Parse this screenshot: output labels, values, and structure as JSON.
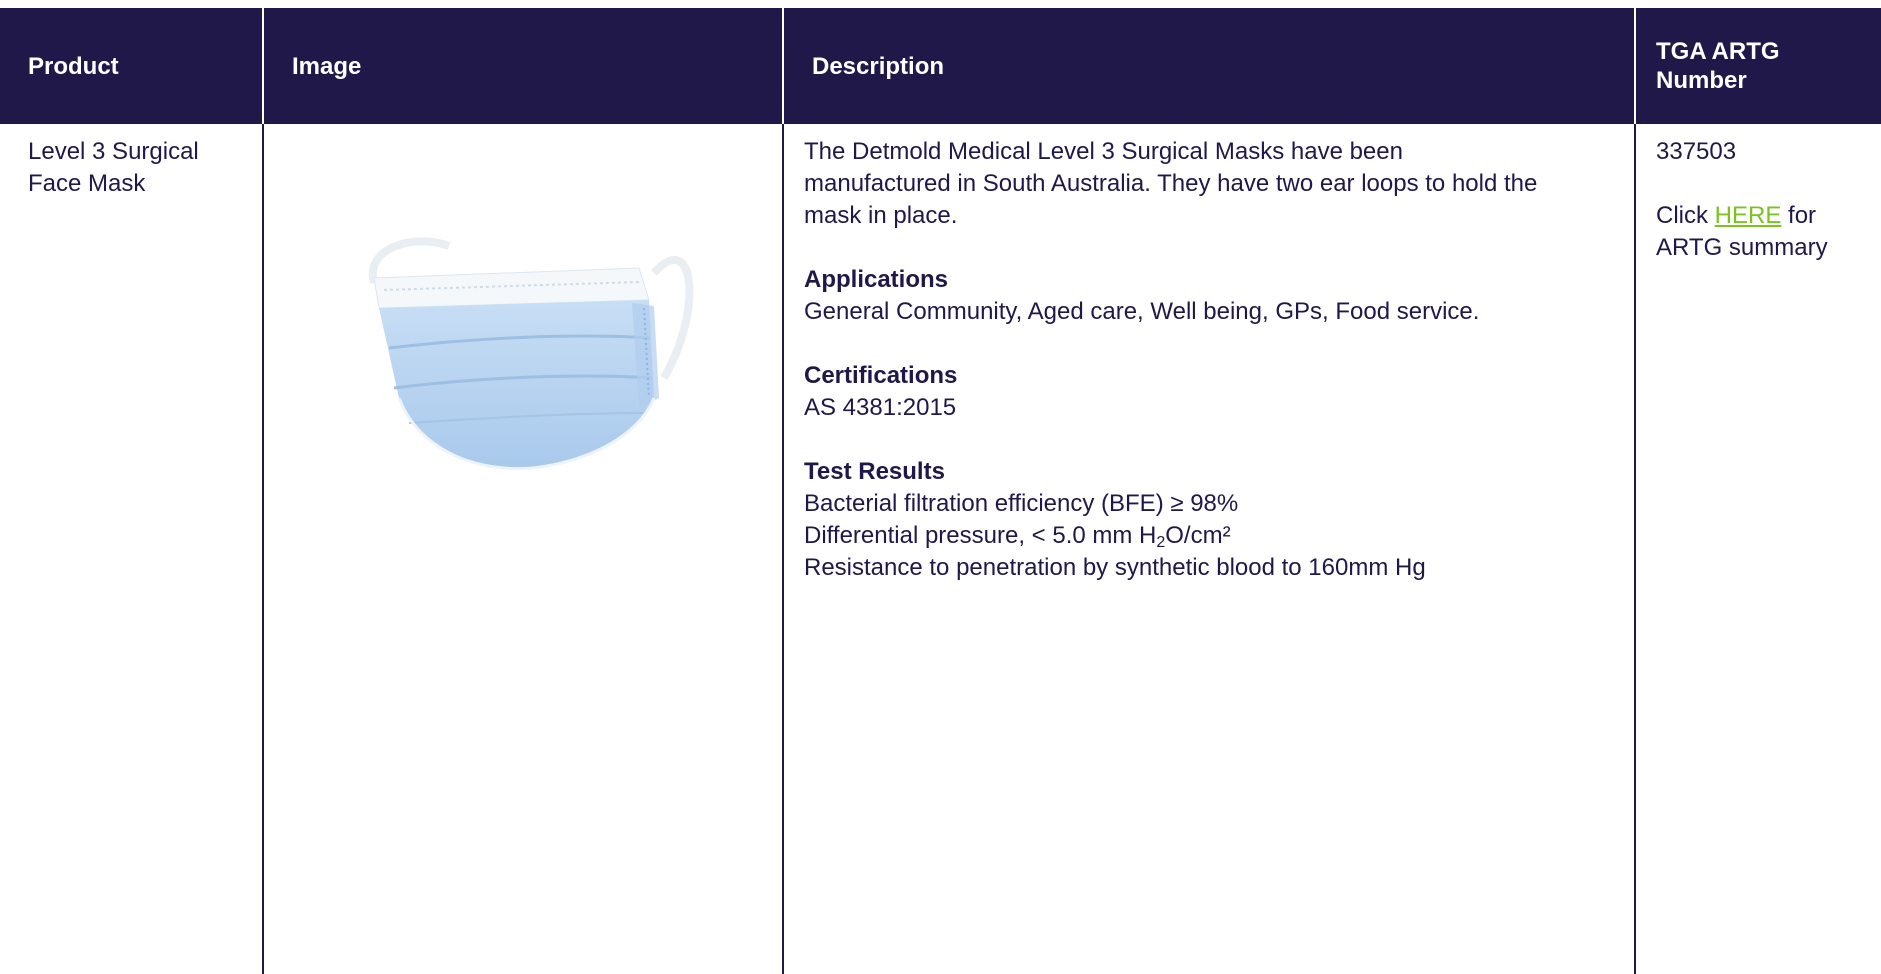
{
  "table": {
    "headers": {
      "product": "Product",
      "image": "Image",
      "description": "Description",
      "artg_line1": "TGA ARTG",
      "artg_line2": "Number"
    },
    "row": {
      "product_line1": "Level 3 Surgical",
      "product_line2": "Face Mask",
      "image_icon": "surgical-mask-icon",
      "description": {
        "intro_line1": "The Detmold Medical Level 3 Surgical Masks have been",
        "intro_line2": "manufactured in South Australia. They have two ear loops to hold the",
        "intro_line3": "mask in place.",
        "applications_title": "Applications",
        "applications_text": "General Community, Aged care, Well being, GPs, Food service.",
        "certifications_title": "Certifications",
        "certifications_text": "AS 4381:2015",
        "test_results_title": "Test Results",
        "test_line1": "Bacterial filtration efficiency (BFE) ≥ 98%",
        "test_line2_prefix": "Differential pressure, < 5.0 mm H",
        "test_line2_sub": "2",
        "test_line2_suffix": "O/cm²",
        "test_line3": "Resistance to penetration by synthetic blood to 160mm Hg"
      },
      "artg": {
        "number": "337503",
        "click_prefix": "Click ",
        "link_text": "HERE",
        "click_suffix": " for",
        "summary_line": "ARTG summary"
      }
    }
  },
  "colors": {
    "header_bg": "#1f1849",
    "text": "#1f1849",
    "link": "#7dc31f",
    "mask_blue": "#b9d6f2"
  }
}
